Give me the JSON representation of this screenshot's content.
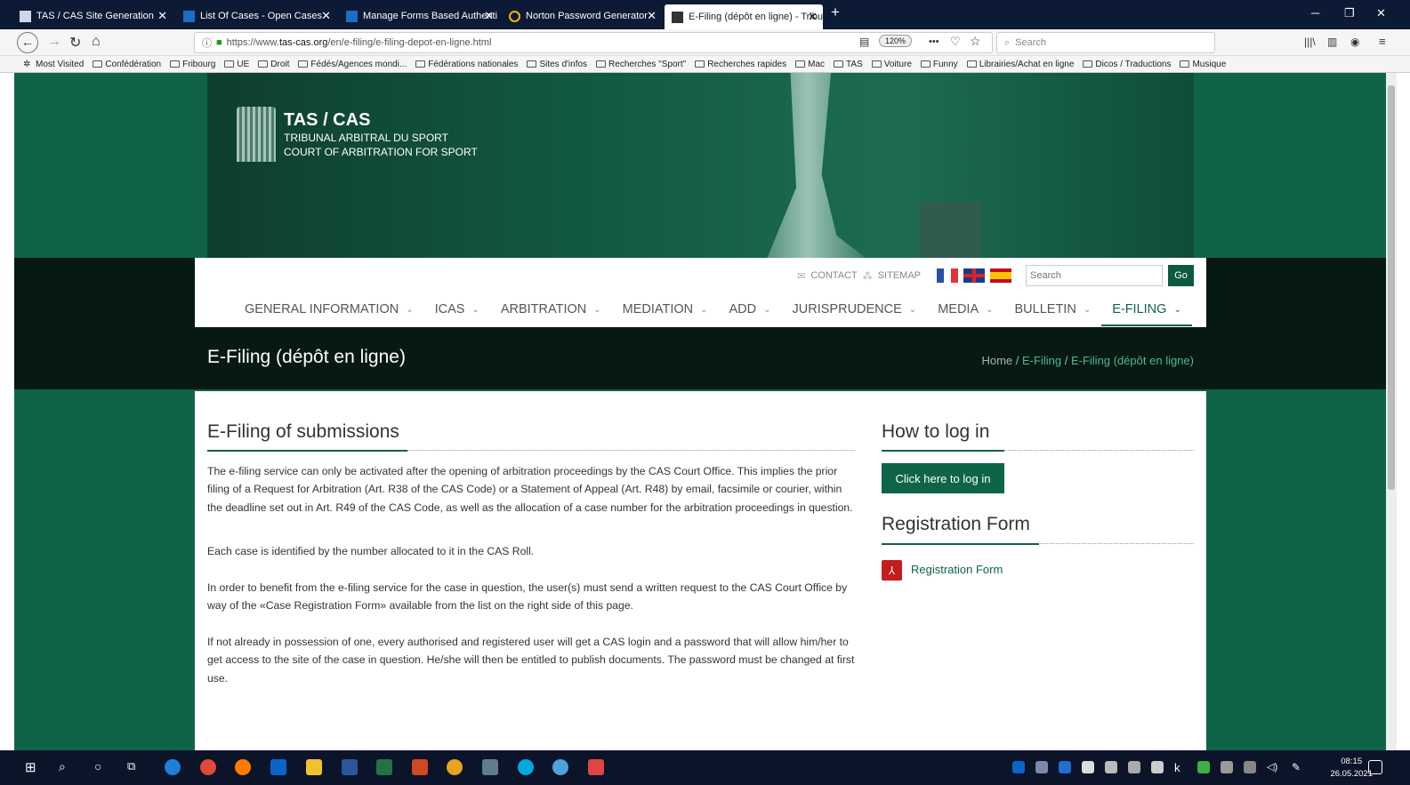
{
  "browser": {
    "tabs": [
      {
        "title": "TAS / CAS Site Generation",
        "active": false
      },
      {
        "title": "List Of Cases - Open Cases",
        "active": false
      },
      {
        "title": "Manage Forms Based Authenti",
        "active": false
      },
      {
        "title": "Norton Password Generator",
        "active": false
      },
      {
        "title": "E-Filing (dépôt en ligne) - Tribu",
        "active": true
      }
    ],
    "new_tab": "+",
    "url_prefix": "https://www.",
    "url_domain": "tas-cas.org",
    "url_path": "/en/e-filing/e-filing-depot-en-ligne.html",
    "zoom": "120%",
    "search_placeholder": "Search",
    "menu_dots": "•••",
    "bookmarks": [
      "Most Visited",
      "Confédération",
      "Fribourg",
      "UE",
      "Droit",
      "Fédés/Agences mondi...",
      "Fédérations nationales",
      "Sites d'infos",
      "Recherches \"Sport\"",
      "Recherches rapides",
      "Mac",
      "TAS",
      "Voiture",
      "Funny",
      "Librairies/Achat en ligne",
      "Dicos / Traductions",
      "Musique"
    ]
  },
  "site": {
    "logo_title": "TAS / CAS",
    "logo_line1": "TRIBUNAL ARBITRAL DU SPORT",
    "logo_line2": "COURT OF ARBITRATION FOR SPORT",
    "contact": "CONTACT",
    "sitemap": "SITEMAP",
    "search_placeholder": "Search",
    "go": "Go",
    "menu": [
      {
        "label": "GENERAL INFORMATION",
        "active": false
      },
      {
        "label": "ICAS",
        "active": false
      },
      {
        "label": "ARBITRATION",
        "active": false
      },
      {
        "label": "MEDIATION",
        "active": false
      },
      {
        "label": "ADD",
        "active": false
      },
      {
        "label": "JURISPRUDENCE",
        "active": false
      },
      {
        "label": "MEDIA",
        "active": false
      },
      {
        "label": "BULLETIN",
        "active": false
      },
      {
        "label": "E-FILING",
        "active": true
      }
    ],
    "page_title": "E-Filing (dépôt en ligne)",
    "breadcrumb": {
      "home": "Home",
      "sep": "/",
      "parent": "E-Filing",
      "current": "E-Filing (dépôt en ligne)"
    }
  },
  "content": {
    "heading": "E-Filing of submissions",
    "paragraphs": [
      "The e-filing service can only be activated after the opening of arbitration proceedings by the CAS Court Office. This implies the prior filing of a Request for Arbitration (Art. R38 of the CAS Code) or a Statement of Appeal (Art. R48) by email, facsimile or courier, within the deadline set out in Art. R49 of the CAS Code, as well as the allocation of a case number for the arbitration proceedings in question.",
      "Each case is identified by the number allocated to it in the CAS Roll.",
      "In order to benefit from the e-filing service for the case in question, the user(s) must send a written request to the CAS Court Office by way of the «Case Registration Form» available from the list on the right side of this page.",
      "If not already in possession of one, every authorised and registered user will get a CAS login and a password that will allow him/her to get access to the site of the case in question. He/she will then be entitled to publish documents. The password must be changed at first use."
    ],
    "login_heading": "How to log in",
    "login_button": "Click here to log in",
    "reg_heading": "Registration Form",
    "reg_link": "Registration Form"
  },
  "taskbar": {
    "time": "08:15",
    "date": "26.05.2021"
  },
  "colors": {
    "brand_green": "#0e6448",
    "dark": "#061a13",
    "titlebar": "#0c1a36"
  }
}
